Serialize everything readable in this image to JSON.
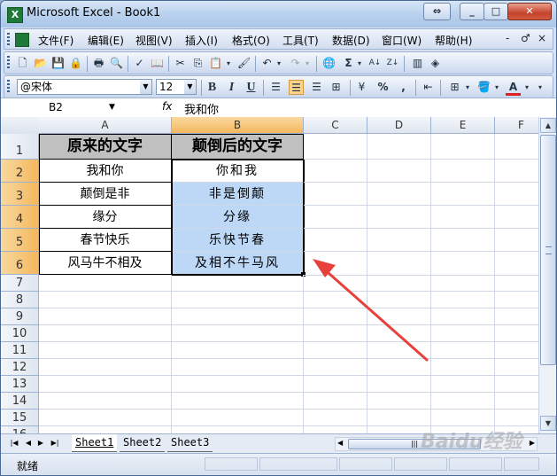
{
  "window": {
    "title": "Microsoft Excel - Book1"
  },
  "menu": {
    "items": [
      "文件(F)",
      "编辑(E)",
      "视图(V)",
      "插入(I)",
      "格式(O)",
      "工具(T)",
      "数据(D)",
      "窗口(W)",
      "帮助(H)"
    ],
    "doc_controls": [
      "-",
      "♂",
      "×"
    ]
  },
  "format_toolbar": {
    "font_name": "@宋体",
    "font_size": "12",
    "percent": "%",
    "comma": ","
  },
  "formula_bar": {
    "name_box": "B2",
    "fx": "fx",
    "value": "我和你"
  },
  "columns": [
    "A",
    "B",
    "C",
    "D",
    "E",
    "F"
  ],
  "rows": [
    "1",
    "2",
    "3",
    "4",
    "5",
    "6",
    "7",
    "8",
    "9",
    "10",
    "11",
    "12",
    "13",
    "14",
    "15",
    "16"
  ],
  "table": {
    "headers": [
      "原来的文字",
      "颠倒后的文字"
    ],
    "original": [
      "我和你",
      "颠倒是非",
      "缘分",
      "春节快乐",
      "风马牛不相及"
    ],
    "reversed": [
      "你和我",
      "非是倒颠",
      "分缘",
      "乐快节春",
      "及相不牛马风"
    ]
  },
  "sheets": [
    "Sheet1",
    "Sheet2",
    "Sheet3"
  ],
  "status": {
    "text": "就绪"
  },
  "watermark": "Baidu经验",
  "colors": {
    "selection": "#bcd8f6",
    "header_fill": "#c0c0c0",
    "arrow": "#e8403b"
  }
}
